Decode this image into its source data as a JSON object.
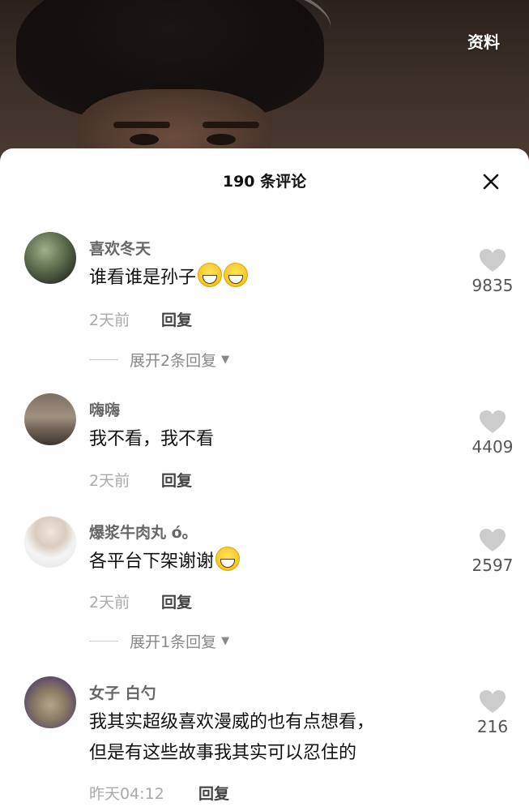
{
  "header": {
    "profile_link": "资料",
    "comment_count": "190 条评论"
  },
  "comments": [
    {
      "user": "喜欢冬天",
      "text": "谁看谁是孙子",
      "emojis": [
        "grinning-emoji",
        "grinning-emoji"
      ],
      "time": "2天前",
      "reply": "回复",
      "likes": "9835",
      "expand": "展开2条回复"
    },
    {
      "user": "嗨嗨",
      "text": "我不看，我不看",
      "time": "2天前",
      "reply": "回复",
      "likes": "4409"
    },
    {
      "user": "爆浆牛肉丸 ó。",
      "text": "各平台下架谢谢",
      "emojis": [
        "facepalm-emoji"
      ],
      "time": "2天前",
      "reply": "回复",
      "likes": "2597",
      "expand": "展开1条回复"
    },
    {
      "user": "女子 白勺",
      "text_line1": "我其实超级喜欢漫威的也有点想看，",
      "text_line2": "但是有这些故事我其实可以忍住的",
      "time": "昨天04:12",
      "reply": "回复",
      "likes": "216"
    }
  ],
  "icons": {
    "close": "close-icon",
    "like": "heart-icon",
    "expand": "triangle-down-icon"
  },
  "colors": {
    "like_icon": "#cccccc",
    "username": "#666666",
    "meta": "#aaaaaa"
  }
}
